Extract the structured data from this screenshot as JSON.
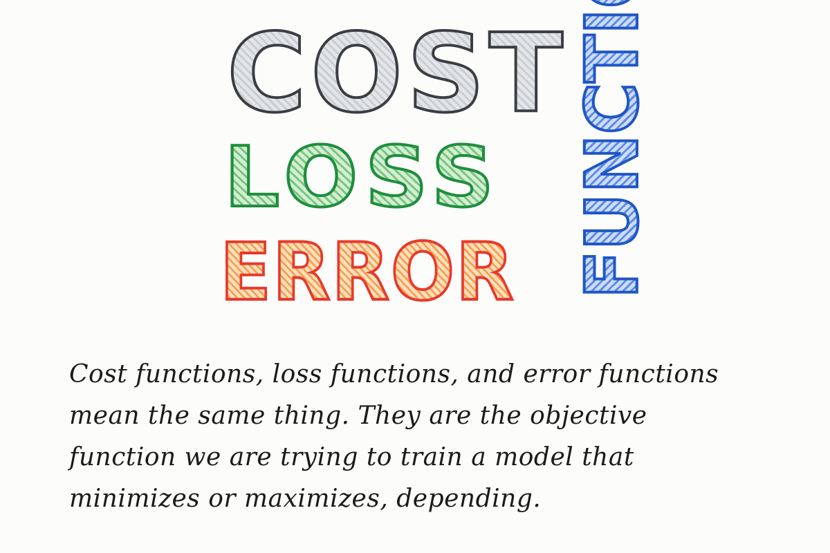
{
  "heading": {
    "word1": "COST",
    "word2": "LOSS",
    "word3": "ERROR",
    "word4": "FUNCTION"
  },
  "body_text": "Cost functions, loss functions, and error functions mean the same thing. They are the objective function we are trying to train a model that minimizes or maximizes, depending.",
  "colors": {
    "cost": "#3a3d42",
    "loss": "#1e8e3e",
    "error": "#e8392c",
    "function": "#1f56c7",
    "ink": "#1a1a1a",
    "paper": "#fcfcfa"
  }
}
